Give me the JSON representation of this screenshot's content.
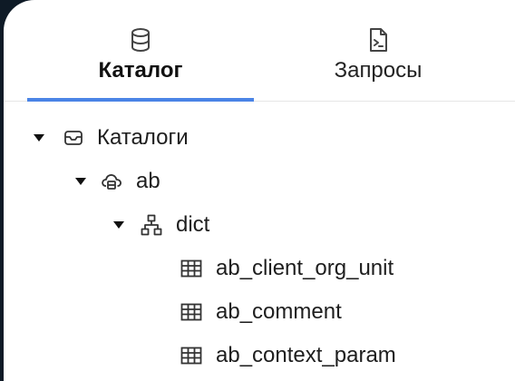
{
  "tabs": [
    {
      "label": "Каталог",
      "icon": "database-icon",
      "active": true
    },
    {
      "label": "Запросы",
      "icon": "query-file-icon",
      "active": false
    }
  ],
  "tree": {
    "root": {
      "label": "Каталоги",
      "icon": "inbox-icon",
      "expanded": true
    },
    "catalog": {
      "label": "ab",
      "icon": "cloud-server-icon",
      "expanded": true
    },
    "schema": {
      "label": "dict",
      "icon": "hierarchy-icon",
      "expanded": true
    },
    "tables": [
      {
        "label": "ab_client_org_unit",
        "icon": "table-icon"
      },
      {
        "label": "ab_comment",
        "icon": "table-icon"
      },
      {
        "label": "ab_context_param",
        "icon": "table-icon"
      }
    ]
  },
  "colors": {
    "accent": "#4a84e6",
    "background": "#ffffff",
    "outer_background": "#0e1a26"
  }
}
